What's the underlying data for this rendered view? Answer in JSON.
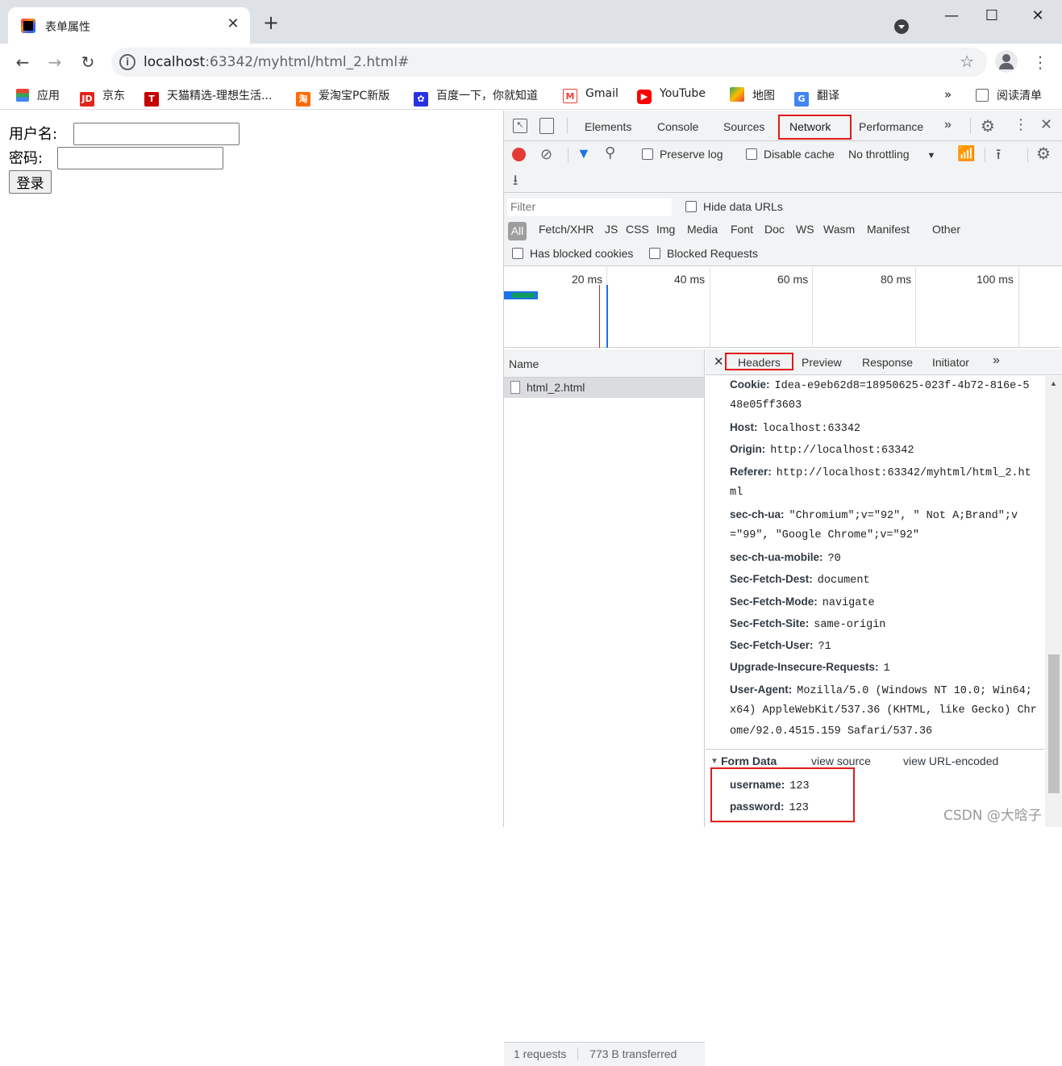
{
  "browser": {
    "tab_title": "表单属性",
    "url_host": "localhost",
    "url_rest": ":63342/myhtml/html_2.html#",
    "bookmarks": [
      "应用",
      "京东",
      "天猫精选-理想生活...",
      "爱淘宝PC新版",
      "百度一下，你就知道",
      "Gmail",
      "YouTube",
      "地图",
      "翻译"
    ],
    "reading_list": "阅读清单",
    "more_bookmarks": "»"
  },
  "page": {
    "username_label": "用户名:",
    "password_label": "密码:",
    "login_button": "登录"
  },
  "devtools": {
    "tabs": [
      "Elements",
      "Console",
      "Sources",
      "Network",
      "Performance"
    ],
    "selected_tab": "Network",
    "preserve_log": "Preserve log",
    "disable_cache": "Disable cache",
    "throttling": "No throttling",
    "filter_placeholder": "Filter",
    "hide_data_urls": "Hide data URLs",
    "types": [
      "All",
      "Fetch/XHR",
      "JS",
      "CSS",
      "Img",
      "Media",
      "Font",
      "Doc",
      "WS",
      "Wasm",
      "Manifest",
      "Other"
    ],
    "has_blocked_cookies": "Has blocked cookies",
    "blocked_requests": "Blocked Requests",
    "timeline_labels": [
      "20 ms",
      "40 ms",
      "60 ms",
      "80 ms",
      "100 ms"
    ],
    "name_header": "Name",
    "requests": [
      "html_2.html"
    ],
    "status": {
      "requests": "1 requests",
      "transferred": "773 B transferred"
    },
    "detail_tabs": [
      "Headers",
      "Preview",
      "Response",
      "Initiator"
    ],
    "headers": [
      {
        "name": "Cookie:",
        "value": "Idea-e9eb62d8=18950625-023f-4b72-816e-5",
        "cont": "48e05ff3603"
      },
      {
        "name": "Host:",
        "value": "localhost:63342"
      },
      {
        "name": "Origin:",
        "value": "http://localhost:63342"
      },
      {
        "name": "Referer:",
        "value": "http://localhost:63342/myhtml/html_2.ht",
        "cont": "ml"
      },
      {
        "name": "sec-ch-ua:",
        "value": "\"Chromium\";v=\"92\", \" Not A;Brand\";v",
        "cont": "=\"99\", \"Google Chrome\";v=\"92\""
      },
      {
        "name": "sec-ch-ua-mobile:",
        "value": "?0"
      },
      {
        "name": "Sec-Fetch-Dest:",
        "value": "document"
      },
      {
        "name": "Sec-Fetch-Mode:",
        "value": "navigate"
      },
      {
        "name": "Sec-Fetch-Site:",
        "value": "same-origin"
      },
      {
        "name": "Sec-Fetch-User:",
        "value": "?1"
      },
      {
        "name": "Upgrade-Insecure-Requests:",
        "value": "1"
      },
      {
        "name": "User-Agent:",
        "value": "Mozilla/5.0 (Windows NT 10.0; Win64;",
        "cont": "x64) AppleWebKit/537.36 (KHTML, like Gecko) Chr",
        "cont2": "ome/92.0.4515.159 Safari/537.36"
      }
    ],
    "form_data": {
      "title": "Form Data",
      "view_source": "view source",
      "view_url_encoded": "view URL-encoded",
      "fields": [
        {
          "name": "username:",
          "value": "123"
        },
        {
          "name": "password:",
          "value": "123"
        }
      ]
    }
  },
  "watermark": "CSDN @大晗子"
}
